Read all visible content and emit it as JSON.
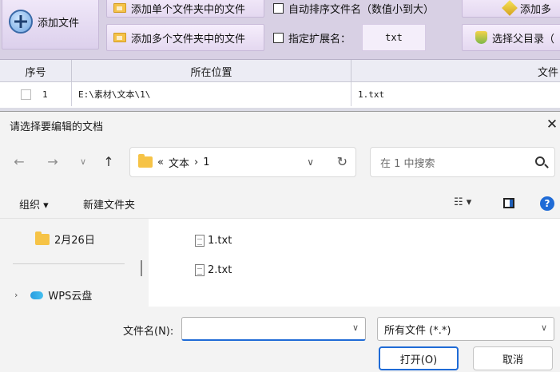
{
  "app": {
    "toolbar": {
      "add_file": "添加文件",
      "add_single_folder": "添加单个文件夹中的文件",
      "add_multi_folder": "添加多个文件夹中的文件",
      "auto_sort": "自动排序文件名（数值小到大）",
      "specify_ext": "指定扩展名：",
      "ext_value": "txt",
      "add_more": "添加多",
      "select_parent": "选择父目录（"
    },
    "grid": {
      "headers": [
        "序号",
        "所在位置",
        "文件"
      ],
      "rows": [
        {
          "index": "1",
          "location": "E:\\素材\\文本\\1\\",
          "file": "1.txt"
        }
      ]
    }
  },
  "dialog": {
    "title": "请选择要编辑的文档",
    "address": {
      "prefix": "«",
      "path1": "文本",
      "sep": "›",
      "path2": "1"
    },
    "search_placeholder": "在 1 中搜索",
    "commands": {
      "organize": "组织 ▾",
      "new_folder": "新建文件夹"
    },
    "nav_items": [
      {
        "label": "2月26日",
        "icon": "folder-icon"
      },
      {
        "label": "WPS云盘",
        "icon": "cloud-icon"
      }
    ],
    "files": [
      {
        "name": "1.txt",
        "icon": "text-file-icon"
      },
      {
        "name": "2.txt",
        "icon": "text-file-icon"
      }
    ],
    "filename_label": "文件名(N):",
    "filename_value": "",
    "filetype": "所有文件 (*.*)",
    "open_button": "打开(O)",
    "cancel_button": "取消"
  },
  "colors": {
    "accent": "#1f6bd6",
    "toolbar_bg": "#d8d0e4",
    "folder": "#f6c346"
  }
}
